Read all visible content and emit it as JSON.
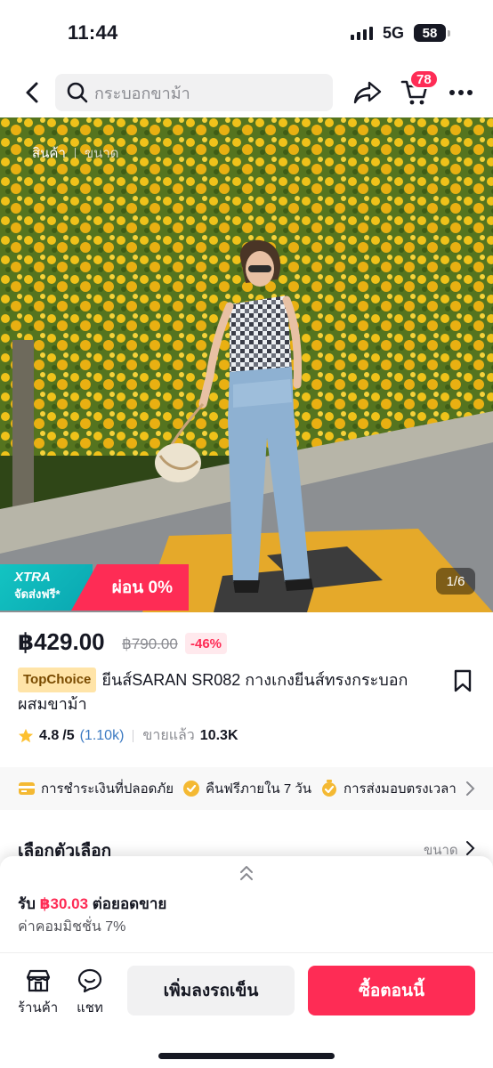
{
  "status_bar": {
    "time": "11:44",
    "network": "5G",
    "battery": "58"
  },
  "nav": {
    "search_placeholder": "กระบอกขาม้า",
    "cart_count": "78"
  },
  "hero": {
    "tabs": [
      "สินค้า",
      "ขนาด"
    ],
    "xtra_title": "XTRA",
    "xtra_sub": "จัดส่งฟรี*",
    "promo": "ผ่อน 0%",
    "counter": "1/6"
  },
  "product": {
    "price": "฿429.00",
    "original_price": "฿790.00",
    "discount": "-46%",
    "badge": "TopChoice",
    "title": "ยีนส์SARAN SR082 กางเกงยีนส์ทรงกระบอกผสมขาม้า",
    "rating": "4.8",
    "rating_max": "/5",
    "review_count": "(1.10k)",
    "sold_label": "ขายแล้ว",
    "sold_count": "10.3K"
  },
  "guarantees": [
    "การชำระเงินที่ปลอดภัย",
    "คืนฟรีภายใน 7 วัน",
    "การส่งมอบตรงเวลา"
  ],
  "options": {
    "title": "เลือกตัวเลือก",
    "right_label": "ขนาด"
  },
  "commission": {
    "prefix": "รับ",
    "amount": "฿30.03",
    "suffix": "ต่อยอดขาย",
    "rate": "ค่าคอมมิชชั่น 7%"
  },
  "bottom_bar": {
    "shop_label": "ร้านค้า",
    "chat_label": "แชท",
    "add_to_cart": "เพิ่มลงรถเข็น",
    "buy_now": "ซื้อตอนนี้"
  },
  "colors": {
    "accent": "#fe2c55",
    "teal": "#13c4c2"
  }
}
